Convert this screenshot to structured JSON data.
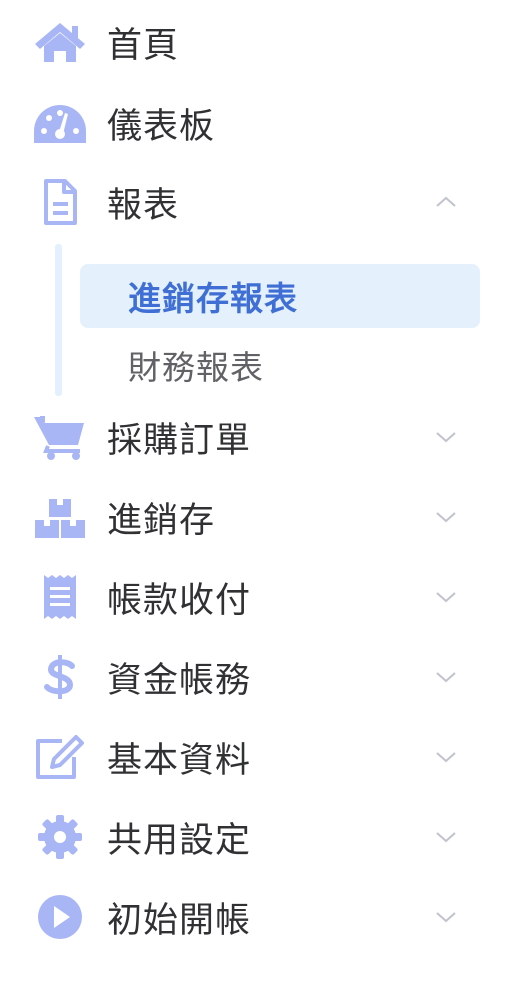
{
  "colors": {
    "icon": "#a9b6f5",
    "text": "#303133",
    "sub_text": "#606266",
    "active_text": "#3f6fd4",
    "active_bg": "#e4f1fc",
    "chevron": "#c0c4cc"
  },
  "menu": [
    {
      "label": "首頁",
      "icon": "home-icon"
    },
    {
      "label": "儀表板",
      "icon": "dashboard-icon"
    },
    {
      "label": "報表",
      "icon": "file-icon",
      "expanded": true,
      "children": [
        {
          "label": "進銷存報表",
          "active": true
        },
        {
          "label": "財務報表",
          "active": false
        }
      ]
    },
    {
      "label": "採購訂單",
      "icon": "cart-icon"
    },
    {
      "label": "進銷存",
      "icon": "boxes-icon"
    },
    {
      "label": "帳款收付",
      "icon": "receipt-icon"
    },
    {
      "label": "資金帳務",
      "icon": "dollar-icon"
    },
    {
      "label": "基本資料",
      "icon": "edit-icon"
    },
    {
      "label": "共用設定",
      "icon": "gear-icon"
    },
    {
      "label": "初始開帳",
      "icon": "play-icon"
    }
  ]
}
